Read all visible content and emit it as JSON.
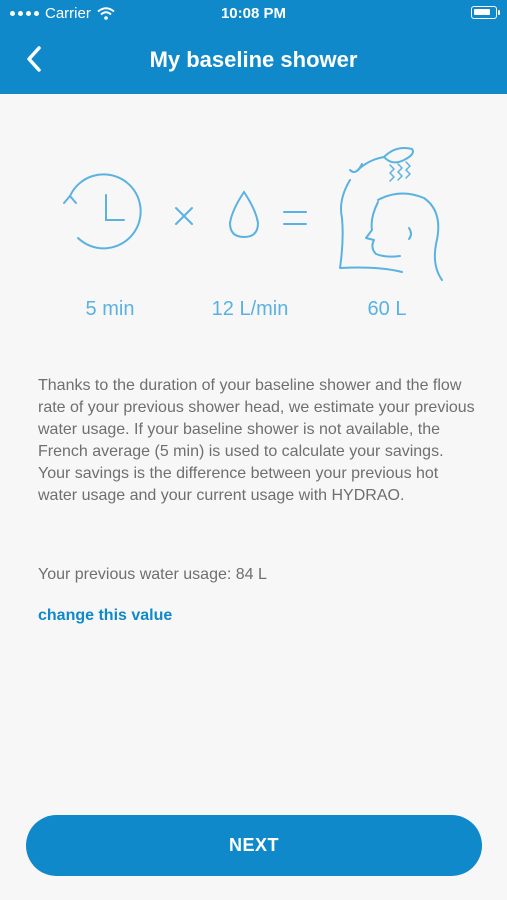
{
  "status_bar": {
    "carrier": "Carrier",
    "time": "10:08 PM"
  },
  "header": {
    "title": "My baseline shower"
  },
  "illustration": {
    "icons": [
      "clock-icon",
      "multiply-icon",
      "water-drop-icon",
      "equals-icon",
      "shower-person-icon"
    ],
    "values": {
      "duration": "5 min",
      "flow_rate": "12 L/min",
      "total": "60 L"
    }
  },
  "body": {
    "description": "Thanks to the duration of your baseline shower and the flow rate of your previous shower head, we estimate your previous water usage. If your baseline shower is not available, the French average (5 min) is used to calculate your savings. Your savings is the difference between your previous hot water usage and your current usage with HYDRAO.",
    "previous_usage": "Your previous water usage: 84 L",
    "change_link": "change this value"
  },
  "footer": {
    "next_label": "NEXT"
  },
  "colors": {
    "accent": "#1089cb",
    "illustration": "#5ab2e0",
    "text": "#6f6f6f",
    "background": "#f7f7f7"
  }
}
